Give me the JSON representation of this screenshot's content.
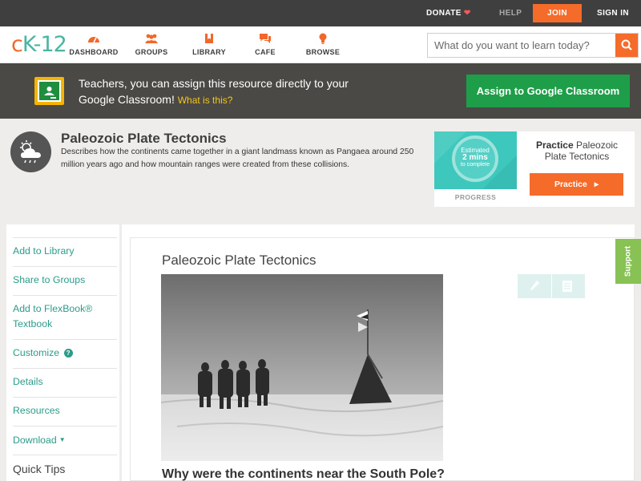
{
  "topbar": {
    "donate": "DONATE",
    "help": "HELP",
    "join": "JOIN",
    "signin": "SIGN IN"
  },
  "logo": {
    "c": "c",
    "k": "K",
    "n": "-12"
  },
  "nav": {
    "items": [
      {
        "label": "DASHBOARD",
        "icon": "dashboard-icon"
      },
      {
        "label": "GROUPS",
        "icon": "groups-icon"
      },
      {
        "label": "LIBRARY",
        "icon": "library-icon"
      },
      {
        "label": "CAFE",
        "icon": "cafe-icon"
      },
      {
        "label": "BROWSE",
        "icon": "browse-icon"
      }
    ],
    "search_placeholder": "What do you want to learn today?"
  },
  "banner": {
    "message": "Teachers, you can assign this resource directly to your Google Classroom!",
    "what_link": "What is this?",
    "assign_button": "Assign to Google Classroom"
  },
  "concept": {
    "title": "Paleozoic Plate Tectonics",
    "description": "Describes how the continents came together in a giant landmass known as Pangaea around 250 million years ago and how mountain ranges were created from these collisions.",
    "practice": {
      "estimate_line1": "Estimated",
      "estimate_line2": "2 mins",
      "estimate_line3": "to complete",
      "progress_label": "PROGRESS",
      "practice_bold": "Practice",
      "practice_name": "Paleozoic Plate Tectonics",
      "practice_button": "Practice"
    }
  },
  "sidebar": {
    "items": [
      {
        "label": "Add to Library"
      },
      {
        "label": "Share to Groups"
      },
      {
        "label": "Add to FlexBook® Textbook"
      },
      {
        "label": "Customize"
      },
      {
        "label": "Details"
      },
      {
        "label": "Resources"
      },
      {
        "label": "Download"
      }
    ],
    "quick_tips": "Quick Tips"
  },
  "article": {
    "title": "Paleozoic Plate Tectonics",
    "question": "Why were the continents near the South Pole?"
  },
  "support": "Support",
  "colors": {
    "orange": "#f46b2a",
    "teal": "#2c9c8a",
    "green": "#1e9e48",
    "banner_bg": "#4a4946",
    "support_green": "#88c255"
  }
}
